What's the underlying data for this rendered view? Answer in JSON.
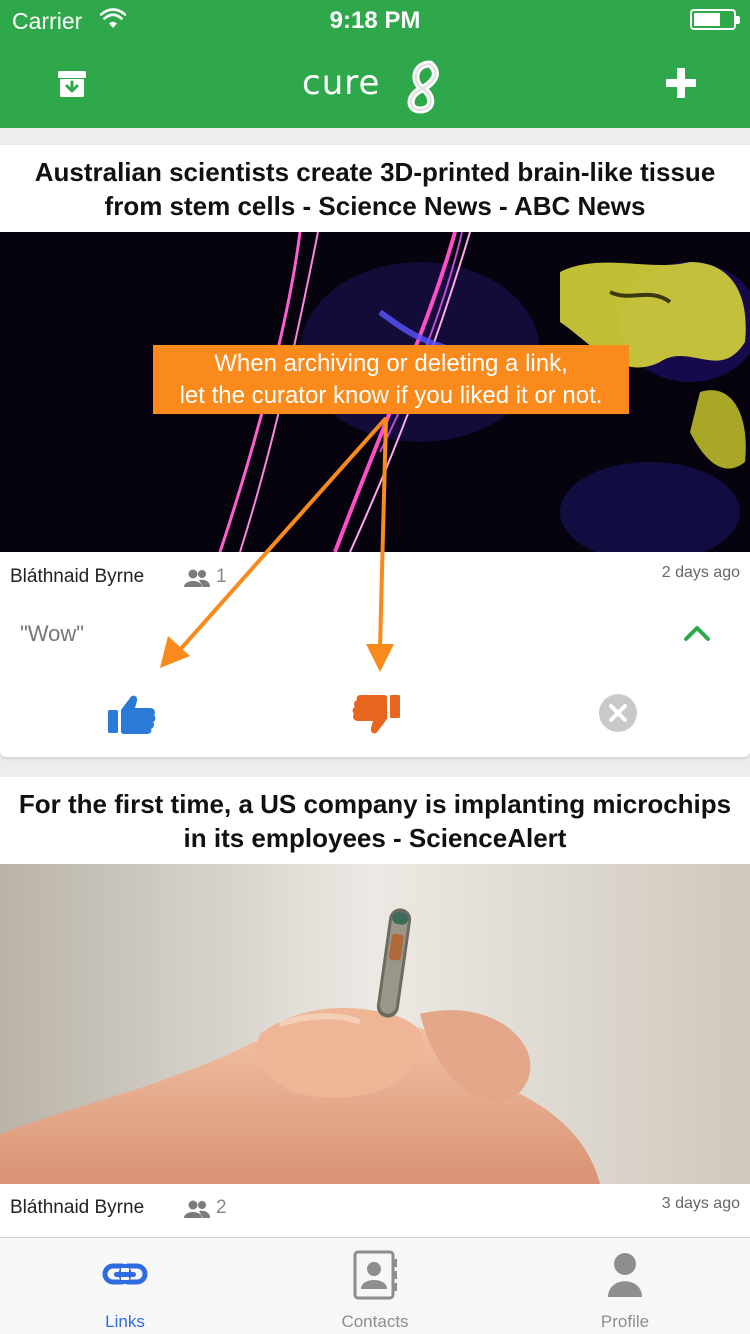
{
  "status_bar": {
    "carrier": "Carrier",
    "time": "9:18 PM"
  },
  "nav": {
    "logo_text": "cure",
    "archive_icon": "archive-icon",
    "add_icon": "plus-icon"
  },
  "colors": {
    "brand_green": "#2ea84a",
    "like_blue": "#2b7bd6",
    "dislike_orange": "#e8651d",
    "tip_orange": "#f98a1b",
    "tab_active": "#2f6ae0"
  },
  "cards": [
    {
      "title": "Australian scientists create 3D-printed brain-like tissue from stem cells - Science News - ABC News",
      "author": "Bláthnaid Byrne",
      "shares": "1",
      "time_ago": "2 days ago",
      "comment": "\"Wow\""
    },
    {
      "title": "For the first time, a US company is implanting microchips in its employees - ScienceAlert",
      "author": "Bláthnaid Byrne",
      "shares": "2",
      "time_ago": "3 days ago"
    }
  ],
  "tooltip": {
    "line1": "When archiving or deleting a link,",
    "line2": "let the curator know if you liked it or not."
  },
  "tabs": [
    {
      "label": "Links",
      "icon": "link-icon",
      "active": true
    },
    {
      "label": "Contacts",
      "icon": "contacts-icon",
      "active": false
    },
    {
      "label": "Profile",
      "icon": "profile-icon",
      "active": false
    }
  ]
}
